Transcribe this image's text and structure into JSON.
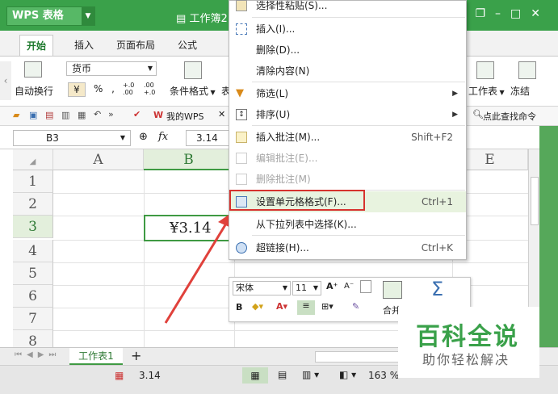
{
  "app": {
    "name": "WPS 表格",
    "doc_title": "工作簿2"
  },
  "tabs": [
    "开始",
    "插入",
    "页面布局",
    "公式"
  ],
  "ribbon": {
    "wrap_text": "自动换行",
    "number_format": "货币",
    "percent": "%",
    "thousands": "‚",
    "inc_decimal": "+.0 .00",
    "dec_decimal": ".00 +.0",
    "cond_format": "条件格式",
    "table_style": "表",
    "worksheet": "工作表",
    "freeze": "冻结"
  },
  "quickbar": {
    "mywps": "我的WPS",
    "find": "点此查找命令"
  },
  "formula": {
    "cell_ref": "B3",
    "fx": "fx",
    "value": "3.14"
  },
  "grid": {
    "columns": [
      "A",
      "B",
      "E"
    ],
    "rows": [
      "1",
      "2",
      "3",
      "4",
      "5",
      "6",
      "7",
      "8"
    ],
    "selected_value": "¥3.14"
  },
  "context_menu": {
    "items": [
      {
        "label": "选择性粘贴(S)...",
        "shortcut": "",
        "disabled": false
      },
      {
        "label": "插入(I)...",
        "shortcut": "",
        "disabled": false
      },
      {
        "label": "删除(D)...",
        "shortcut": "",
        "disabled": false
      },
      {
        "label": "清除内容(N)",
        "shortcut": "",
        "disabled": false
      },
      {
        "label": "筛选(L)",
        "shortcut": "",
        "disabled": false
      },
      {
        "label": "排序(U)",
        "shortcut": "",
        "disabled": false
      },
      {
        "label": "插入批注(M)...",
        "shortcut": "Shift+F2",
        "disabled": false
      },
      {
        "label": "编辑批注(E)...",
        "shortcut": "",
        "disabled": true
      },
      {
        "label": "删除批注(M)",
        "shortcut": "",
        "disabled": true
      },
      {
        "label": "设置单元格格式(F)...",
        "shortcut": "Ctrl+1",
        "disabled": false
      },
      {
        "label": "从下拉列表中选择(K)...",
        "shortcut": "",
        "disabled": false
      },
      {
        "label": "超链接(H)...",
        "shortcut": "Ctrl+K",
        "disabled": false
      }
    ]
  },
  "mini_toolbar": {
    "font": "宋体",
    "size": "11",
    "bold": "B",
    "merge": "合并",
    "sum": "Σ"
  },
  "sheet": {
    "name": "工作表1",
    "add": "+"
  },
  "status": {
    "value": "3.14",
    "zoom": "163 %"
  },
  "watermark": {
    "title": "百科全说",
    "subtitle": "助你轻松解决"
  },
  "colors": {
    "brand_green": "#3aa14a",
    "highlight": "#d7332e"
  }
}
